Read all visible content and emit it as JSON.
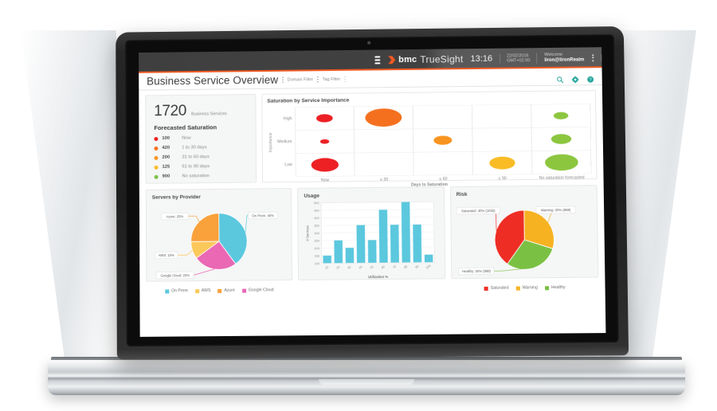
{
  "appbar": {
    "menu_icon": "hamburger-icon",
    "brand": "bmc",
    "product": "TrueSight",
    "clock": "13:16",
    "date": "22/02/2016",
    "timezone": "GMT+02:00",
    "welcome_label": "Welcome",
    "username": "liron@lironRealm",
    "more_icon": "kebab-menu-icon"
  },
  "titlebar": {
    "title": "Business Service Overview",
    "domain_filter": "Domain Filter",
    "tag_filter": "Tag Filter",
    "icons": [
      "search-icon",
      "gear-icon",
      "help-icon"
    ],
    "icon_color": "#22a59b"
  },
  "kpi": {
    "count": "1720",
    "count_label": "Business Services",
    "section_title": "Forecasted Saturation",
    "rows": [
      {
        "value": "100",
        "label": "Now",
        "color": "#ed2024"
      },
      {
        "value": "420",
        "label": "1 to 30 days",
        "color": "#f4701f"
      },
      {
        "value": "200",
        "label": "31 to 60 days",
        "color": "#f79420"
      },
      {
        "value": "125",
        "label": "61 to 90 days",
        "color": "#f9bc25"
      },
      {
        "value": "900",
        "label": "No saturation",
        "color": "#7ac143"
      }
    ]
  },
  "chart_data": [
    {
      "id": "saturation-by-service-importance",
      "type": "scatter",
      "title": "Saturation by Service Importance",
      "xlabel": "Days to Saturation",
      "ylabel": "Importance",
      "categories": [
        "Now",
        "≤ 30",
        "≤ 60",
        "≤ 90",
        "No saturation forecasted"
      ],
      "ycategories": [
        "High",
        "Medium",
        "Low"
      ],
      "grid": true,
      "points": [
        {
          "x": "Now",
          "y": "High",
          "size": 9,
          "color": "#ed2024"
        },
        {
          "x": "Now",
          "y": "Medium",
          "size": 5,
          "color": "#ed2024"
        },
        {
          "x": "Now",
          "y": "Low",
          "size": 15,
          "color": "#ed2024"
        },
        {
          "x": "≤ 30",
          "y": "High",
          "size": 20,
          "color": "#f4701f"
        },
        {
          "x": "≤ 60",
          "y": "Medium",
          "size": 10,
          "color": "#f79420"
        },
        {
          "x": "≤ 90",
          "y": "Low",
          "size": 14,
          "color": "#f9bc25"
        },
        {
          "x": "No saturation forecasted",
          "y": "High",
          "size": 8,
          "color": "#8cc63f"
        },
        {
          "x": "No saturation forecasted",
          "y": "Medium",
          "size": 11,
          "color": "#8cc63f"
        },
        {
          "x": "No saturation forecasted",
          "y": "Low",
          "size": 18,
          "color": "#8cc63f"
        }
      ]
    },
    {
      "id": "servers-by-provider",
      "type": "pie",
      "title": "Servers by Provider",
      "legend_position": "bottom",
      "slices": [
        {
          "name": "On Prem",
          "value": 40,
          "color": "#5bc8de",
          "callout": "On Prem: 40%"
        },
        {
          "name": "Google Cloud",
          "value": 25,
          "color": "#ea68b4",
          "callout": "Google Cloud: 25%"
        },
        {
          "name": "AWS",
          "value": 10,
          "color": "#fbc85a",
          "callout": "AWS: 10%"
        },
        {
          "name": "Azure",
          "value": 25,
          "color": "#f9a13a",
          "callout": "Azure: 25%"
        }
      ]
    },
    {
      "id": "usage",
      "type": "bar",
      "title": "Usage",
      "xlabel": "Utilization %",
      "ylabel": "# Services",
      "categories": [
        "10",
        "20",
        "30",
        "40",
        "50",
        "60",
        "70",
        "80",
        "90",
        "100"
      ],
      "values": [
        150,
        250,
        200,
        350,
        250,
        450,
        350,
        500,
        350,
        150
      ],
      "yticks": [
        100,
        150,
        200,
        250,
        300,
        350,
        400,
        450,
        500
      ],
      "ylim": [
        100,
        500
      ],
      "bar_color": "#5bc8de",
      "grid": true
    },
    {
      "id": "risk",
      "type": "pie",
      "title": "Risk",
      "legend_position": "bottom",
      "slices": [
        {
          "name": "Saturated",
          "value": 40,
          "count": 1032,
          "color": "#ee2e24",
          "callout": "Saturated: 40% (1032)"
        },
        {
          "name": "Warning",
          "value": 30,
          "count": 988,
          "color": "#f6b221",
          "callout": "Warning: 30% (988)"
        },
        {
          "name": "Healthy",
          "value": 30,
          "count": 988,
          "color": "#7ac143",
          "callout": "Healthy: 30% (988)"
        }
      ]
    }
  ]
}
